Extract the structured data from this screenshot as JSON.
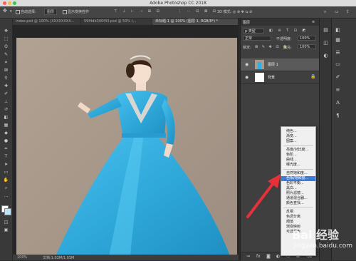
{
  "window": {
    "title": "Adobe Photoshop CC 2018"
  },
  "options_bar": {
    "auto_select_label": "自动选择:",
    "auto_select_value": "图层",
    "show_transform_label": "显示变换控件"
  },
  "tabs": [
    {
      "label": "index.psd @ 100% (XXXXXXXX..."
    },
    {
      "label": "59f4db300f43.psd @ 50% (..."
    },
    {
      "label": "未标题-1 @ 100% (图层 1, RGB/8*) *"
    }
  ],
  "status_bar": {
    "zoom": "100%",
    "doc_info": "文档:1.03M/1.03M"
  },
  "layers_panel": {
    "title": "图层",
    "filter_label": "p 类型",
    "blend_mode": "正常",
    "opacity_label": "不透明度:",
    "opacity_value": "100%",
    "lock_label": "锁定:",
    "fill_label": "填充:",
    "fill_value": "100%",
    "layers": [
      {
        "name": "图层 1",
        "selected": true
      },
      {
        "name": "背景",
        "selected": false
      }
    ]
  },
  "adjustment_menu": {
    "groups": [
      [
        "纯色...",
        "渐变...",
        "图案..."
      ],
      [
        "亮度/对比度...",
        "色阶...",
        "曲线...",
        "曝光度..."
      ],
      [
        "自然饱和度...",
        "色相/饱和度...",
        "色彩平衡...",
        "黑白...",
        "照片滤镜...",
        "通道混合器...",
        "颜色查找..."
      ],
      [
        "反相",
        "色调分离",
        "阈值",
        "渐变映射",
        "可选颜色"
      ]
    ],
    "highlighted": "色相/饱和度..."
  },
  "watermark": {
    "brand": "Bai 经验",
    "url": "jingyan.baidu.com"
  },
  "colors": {
    "accent_highlight": "#3d7bd9",
    "arrow": "#e8303a",
    "dress": "#33aee0",
    "backdrop": "#a99a8c"
  }
}
